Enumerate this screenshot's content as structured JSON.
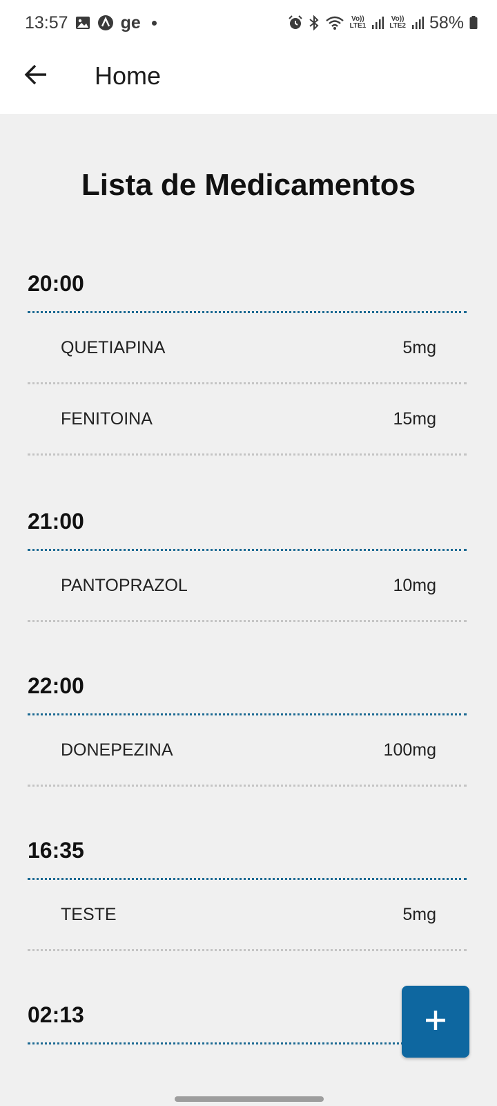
{
  "status_bar": {
    "time": "13:57",
    "app_text": "ge",
    "battery": "58%",
    "lte1": "Vo))\nLTE1",
    "lte2": "Vo))\nLTE2",
    "icons": [
      "gallery-icon",
      "app-a-icon",
      "alarm-icon",
      "bluetooth-icon",
      "wifi-icon",
      "signal-icon",
      "battery-icon"
    ]
  },
  "app_bar": {
    "title": "Home",
    "back_icon": "arrow-back-icon"
  },
  "main": {
    "heading": "Lista de Medicamentos",
    "groups": [
      {
        "time": "20:00",
        "items": [
          {
            "name": "QUETIAPINA",
            "dose": "5mg"
          },
          {
            "name": "FENITOINA",
            "dose": "15mg"
          }
        ]
      },
      {
        "time": "21:00",
        "items": [
          {
            "name": "PANTOPRAZOL",
            "dose": "10mg"
          }
        ]
      },
      {
        "time": "22:00",
        "items": [
          {
            "name": "DONEPEZINA",
            "dose": "100mg"
          }
        ]
      },
      {
        "time": "16:35",
        "items": [
          {
            "name": "TESTE",
            "dose": "5mg"
          }
        ]
      },
      {
        "time": "02:13",
        "items": []
      }
    ]
  },
  "fab": {
    "icon": "plus-icon"
  },
  "colors": {
    "accent": "#0e67a0",
    "time_divider": "#1d6a93",
    "row_divider": "#c4c4c4",
    "background": "#f0f0f0"
  }
}
